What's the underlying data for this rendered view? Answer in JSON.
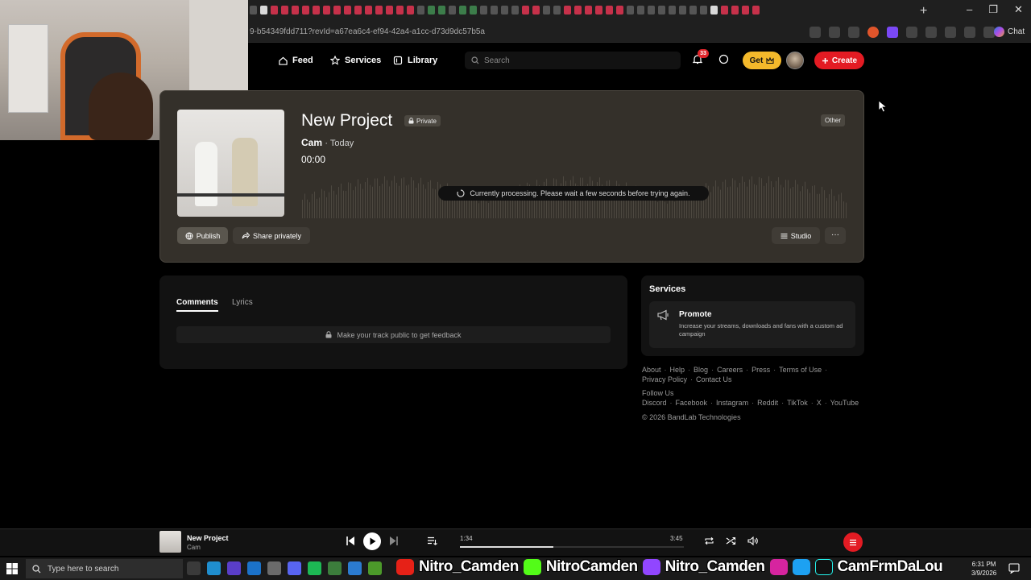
{
  "browser": {
    "url": "9-b54349fdd711?revId=a67ea6c4-ef94-42a4-a1cc-d73d9dc57b5a",
    "new_tab": "+",
    "chat_label": "Chat",
    "window_controls": [
      "–",
      "❐",
      "✕"
    ]
  },
  "nav": {
    "feed": "Feed",
    "services": "Services",
    "library": "Library",
    "search_placeholder": "Search",
    "notifications_count": "33",
    "get_label": "Get",
    "create_label": "Create"
  },
  "project": {
    "title": "New Project",
    "visibility": "Private",
    "artist": "Cam",
    "date": "· Today",
    "time": "00:00",
    "genre": "Other",
    "processing_message": "Currently processing. Please wait a few seconds before trying again.",
    "publish_label": "Publish",
    "share_label": "Share privately",
    "studio_label": "Studio",
    "more_label": "···"
  },
  "comments": {
    "tab_comments": "Comments",
    "tab_lyrics": "Lyrics",
    "feedback_message": "Make your track public to get feedback"
  },
  "services": {
    "title": "Services",
    "promote_title": "Promote",
    "promote_desc": "Increase your streams, downloads and fans with a custom ad campaign"
  },
  "footer": {
    "row1": [
      "About",
      "Help",
      "Blog",
      "Careers",
      "Press",
      "Terms of Use"
    ],
    "row2": [
      "Privacy Policy",
      "Contact Us"
    ],
    "follow_us": "Follow Us",
    "row3": [
      "Discord",
      "Facebook",
      "Instagram",
      "Reddit",
      "TikTok",
      "X",
      "YouTube"
    ],
    "copyright": "© 2026 BandLab Technologies"
  },
  "player": {
    "title": "New Project",
    "artist": "Cam",
    "current_time": "1:34",
    "duration": "3:45",
    "progress_fraction": 0.418
  },
  "taskbar": {
    "search_placeholder": "Type here to search",
    "social_youtube": "Nitro_Camden",
    "social_kick": "NitroCamden",
    "social_twitch": "Nitro_Camden",
    "social_other": "CamFrmDaLou",
    "time": "6:31 PM",
    "date": "3/9/2026"
  },
  "colors": {
    "brand_red": "#e31b23",
    "get_yellow": "#f4b92b",
    "card_bg": "#34302a"
  }
}
